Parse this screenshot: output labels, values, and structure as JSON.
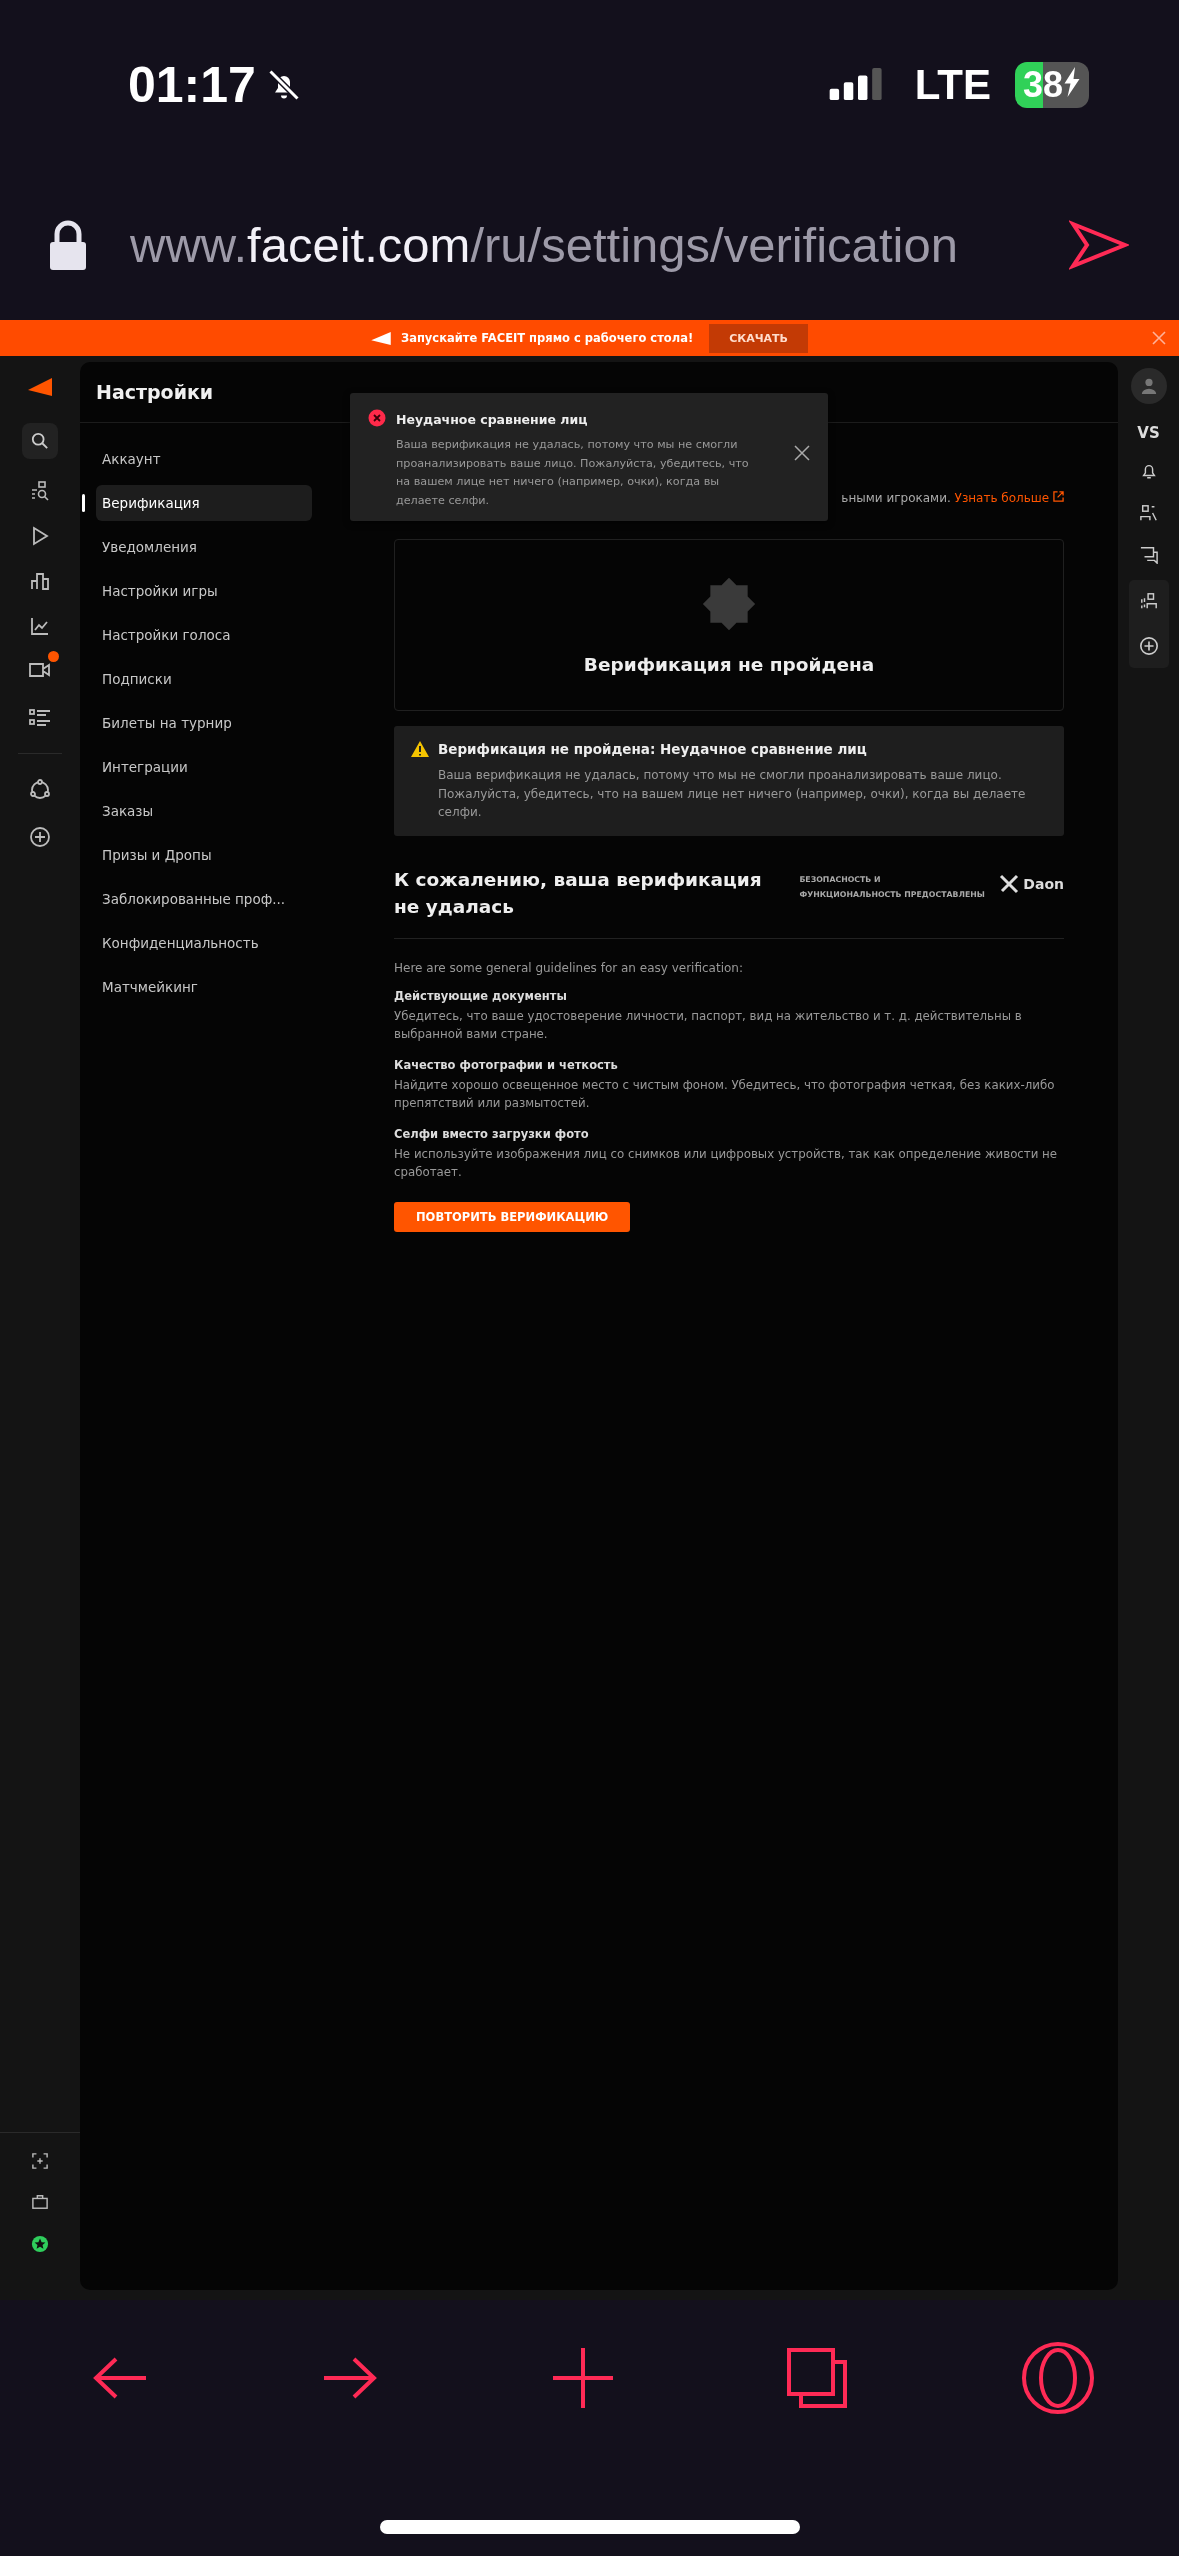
{
  "status_bar": {
    "time": "01:17",
    "network": "LTE",
    "battery": "38"
  },
  "browser": {
    "url_prefix": "www.",
    "url_domain": "faceit.com",
    "url_path": "/ru/settings/verification"
  },
  "banner": {
    "text": "Запускайте FACEIT прямо с рабочего стола!",
    "button": "СКАЧАТЬ"
  },
  "left_rail": {
    "video_notification": true
  },
  "settings": {
    "title": "Настройки",
    "items": [
      {
        "label": "Аккаунт",
        "selected": false
      },
      {
        "label": "Верификация",
        "selected": true
      },
      {
        "label": "Уведомления",
        "selected": false
      },
      {
        "label": "Настройки игры",
        "selected": false
      },
      {
        "label": "Настройки голоса",
        "selected": false
      },
      {
        "label": "Подписки",
        "selected": false
      },
      {
        "label": "Билеты на турнир",
        "selected": false
      },
      {
        "label": "Интеграции",
        "selected": false
      },
      {
        "label": "Заказы",
        "selected": false
      },
      {
        "label": "Призы и Дропы",
        "selected": false
      },
      {
        "label": "Заблокированные проф...",
        "selected": false
      },
      {
        "label": "Конфиденциальность",
        "selected": false
      },
      {
        "label": "Матчмейкинг",
        "selected": false
      }
    ]
  },
  "right_rail": {
    "vs": "VS"
  },
  "toast": {
    "title": "Неудачное сравнение лиц",
    "message": "Ваша верификация не удалась, потому что мы не смогли проанализировать ваше лицо. Пожалуйста, убедитесь, что на вашем лице нет ничего (например, очки), когда вы делаете селфи."
  },
  "intro": {
    "text": "ьными игроками.",
    "link": "Узнать больше"
  },
  "status_card": {
    "title": "Верификация не пройдена"
  },
  "alert": {
    "title": "Верификация не пройдена: Неудачное сравнение лиц",
    "message": "Ваша верификация не удалась, потому что мы не смогли проанализировать ваше лицо. Пожалуйста, убедитесь, что на вашем лице нет ничего (например, очки), когда вы делаете селфи."
  },
  "result": {
    "heading": "К сожалению, ваша верификация не удалась",
    "provider_label": "БЕЗОПАСНОСТЬ И ФУНКЦИОНАЛЬНОСТЬ ПРЕДОСТАВЛЕНЫ",
    "provider": "Daon",
    "intro": "Here are some general guidelines for an easy verification:",
    "guidelines": [
      {
        "title": "Действующие документы",
        "text": "Убедитесь, что ваше удостоверение личности, паспорт, вид на жительство и т. д. действительны в выбранной вами стране."
      },
      {
        "title": "Качество фотографии и четкость",
        "text": "Найдите хорошо освещенное место с чистым фоном. Убедитесь, что фотография четкая, без каких-либо препятствий или размытостей."
      },
      {
        "title": "Селфи вместо загрузки фото",
        "text": "Не используйте изображения лиц со снимков или цифровых устройств, так как определение живости не сработает."
      }
    ],
    "button": "ПОВТОРИТЬ ВЕРИФИКАЦИЮ"
  }
}
